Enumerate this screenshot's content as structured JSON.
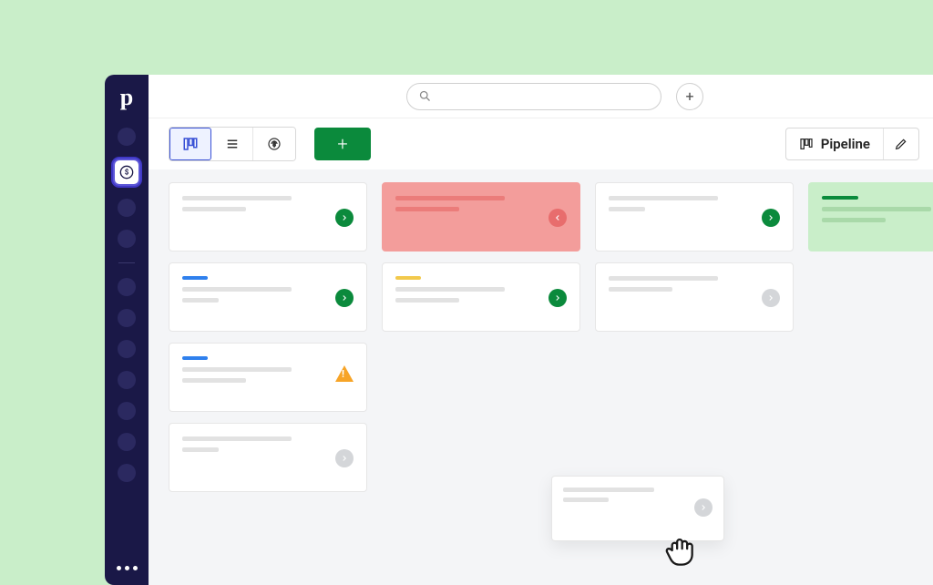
{
  "sidebar": {
    "logo": "p",
    "active_icon": "currency-dollar-icon"
  },
  "topbar": {
    "search_placeholder": "",
    "add_label": "+"
  },
  "toolbar": {
    "view_kanban": "kanban-icon",
    "view_list": "list-icon",
    "view_forecast": "forecast-icon",
    "add_label": "+",
    "pipeline_label": "Pipeline",
    "edit_icon": "pencil-icon"
  },
  "board": {
    "columns": [
      {
        "cards": [
          {
            "stripe": null,
            "status": "green"
          },
          {
            "stripe": "blue",
            "status": "green"
          },
          {
            "stripe": "blue",
            "status": "warn"
          },
          {
            "stripe": null,
            "status": "grey"
          }
        ]
      },
      {
        "cards": [
          {
            "stripe": null,
            "status": "red",
            "variant": "rot"
          },
          {
            "stripe": "yellow",
            "status": "green"
          }
        ]
      },
      {
        "cards": [
          {
            "stripe": null,
            "status": "green"
          },
          {
            "stripe": null,
            "status": "grey"
          }
        ]
      },
      {
        "cards": [
          {
            "stripe": "green",
            "status": null,
            "variant": "won"
          }
        ]
      }
    ],
    "dragging": {
      "status": "grey"
    }
  }
}
